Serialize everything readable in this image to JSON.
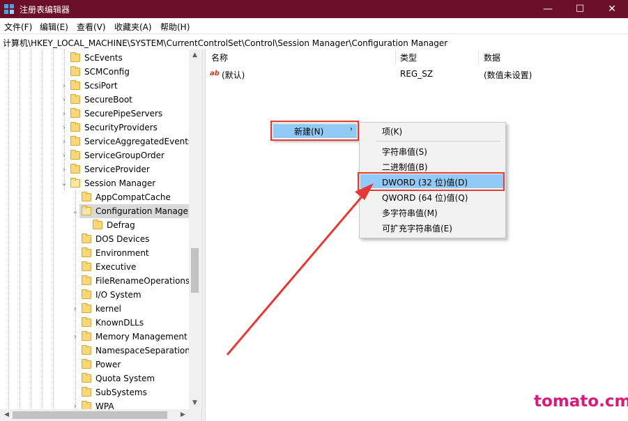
{
  "window": {
    "title": "注册表编辑器",
    "controls": {
      "minimize": "—",
      "maximize": "☐",
      "close": "✕"
    }
  },
  "menu": [
    "文件(F)",
    "编辑(E)",
    "查看(V)",
    "收藏夹(A)",
    "帮助(H)"
  ],
  "address": "计算机\\HKEY_LOCAL_MACHINE\\SYSTEM\\CurrentControlSet\\Control\\Session Manager\\Configuration Manager",
  "tree": {
    "items": [
      {
        "label": "ScEvents",
        "level": 0,
        "expander": "none"
      },
      {
        "label": "SCMConfig",
        "level": 0,
        "expander": "none"
      },
      {
        "label": "ScsiPort",
        "level": 0,
        "expander": "collapsed"
      },
      {
        "label": "SecureBoot",
        "level": 0,
        "expander": "collapsed"
      },
      {
        "label": "SecurePipeServers",
        "level": 0,
        "expander": "collapsed"
      },
      {
        "label": "SecurityProviders",
        "level": 0,
        "expander": "collapsed"
      },
      {
        "label": "ServiceAggregatedEvents",
        "level": 0,
        "expander": "collapsed"
      },
      {
        "label": "ServiceGroupOrder",
        "level": 0,
        "expander": "collapsed"
      },
      {
        "label": "ServiceProvider",
        "level": 0,
        "expander": "collapsed"
      },
      {
        "label": "Session Manager",
        "level": 0,
        "expander": "expanded"
      },
      {
        "label": "AppCompatCache",
        "level": 1,
        "expander": "none"
      },
      {
        "label": "Configuration Manager",
        "level": 1,
        "expander": "expanded",
        "selected": true
      },
      {
        "label": "Defrag",
        "level": 2,
        "expander": "none"
      },
      {
        "label": "DOS Devices",
        "level": 1,
        "expander": "none"
      },
      {
        "label": "Environment",
        "level": 1,
        "expander": "none"
      },
      {
        "label": "Executive",
        "level": 1,
        "expander": "none"
      },
      {
        "label": "FileRenameOperations",
        "level": 1,
        "expander": "none"
      },
      {
        "label": "I/O System",
        "level": 1,
        "expander": "none"
      },
      {
        "label": "kernel",
        "level": 1,
        "expander": "collapsed"
      },
      {
        "label": "KnownDLLs",
        "level": 1,
        "expander": "none"
      },
      {
        "label": "Memory Management",
        "level": 1,
        "expander": "collapsed"
      },
      {
        "label": "NamespaceSeparation",
        "level": 1,
        "expander": "none"
      },
      {
        "label": "Power",
        "level": 1,
        "expander": "none"
      },
      {
        "label": "Quota System",
        "level": 1,
        "expander": "none"
      },
      {
        "label": "SubSystems",
        "level": 1,
        "expander": "none"
      },
      {
        "label": "WPA",
        "level": 1,
        "expander": "collapsed"
      }
    ],
    "scroll": {
      "up": "▲",
      "down": "▼",
      "left": "◀",
      "right": "▶"
    }
  },
  "list": {
    "columns": {
      "name": "名称",
      "type": "类型",
      "data": "数据"
    },
    "rows": [
      {
        "icon": "ab",
        "name": "(默认)",
        "type": "REG_SZ",
        "data": "(数值未设置)"
      }
    ]
  },
  "context_menu": {
    "new_label": "新建(N)",
    "new_arrow": "›",
    "submenu": [
      "项(K)",
      "字符串值(S)",
      "二进制值(B)",
      "DWORD (32 位)值(D)",
      "QWORD (64 位)值(Q)",
      "多字符串值(M)",
      "可扩充字符串值(E)"
    ]
  },
  "annotation_color": "#e53935",
  "watermark": "tomato.cm"
}
